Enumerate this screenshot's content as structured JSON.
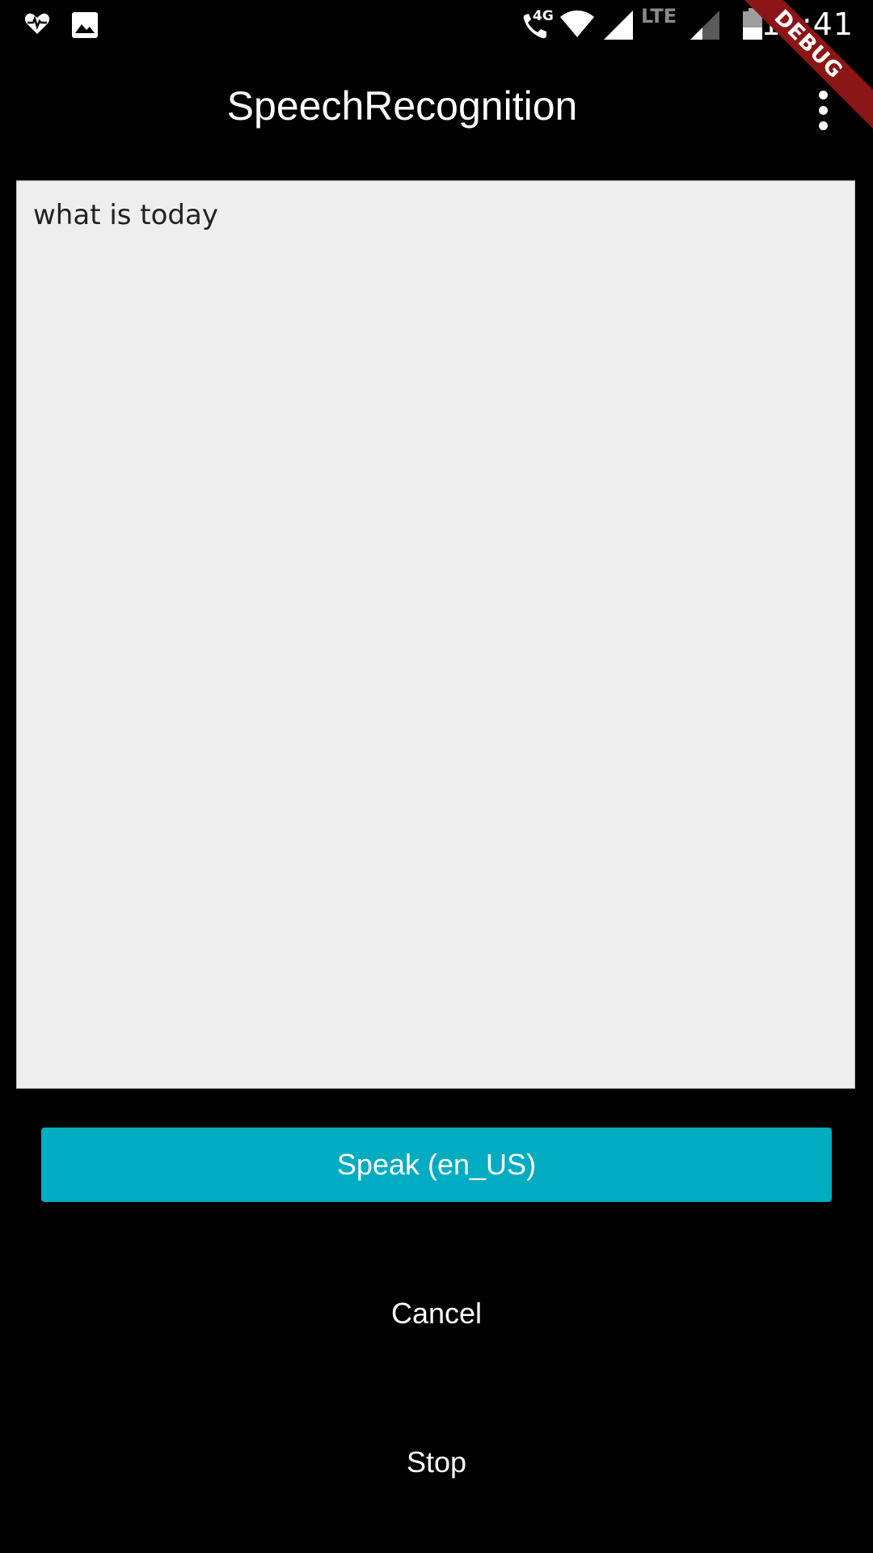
{
  "status_bar": {
    "time": "12:41",
    "network_4g": "4G",
    "network_lte": "LTE",
    "icons": [
      "health-icon",
      "image-icon",
      "wifi-call-icon",
      "wifi-icon",
      "signal-icon",
      "signal-weak-icon",
      "battery-icon"
    ]
  },
  "debug_banner": "DEBUG",
  "app_bar": {
    "title": "SpeechRecognition",
    "menu_icon": "more-vert-icon"
  },
  "transcript": {
    "text": "what is today"
  },
  "buttons": {
    "speak_label": "Speak (en_US)",
    "cancel_label": "Cancel",
    "stop_label": "Stop"
  },
  "colors": {
    "background": "#000000",
    "accent": "#00acc1",
    "panel": "#eeeeee",
    "debug": "#8b1515"
  }
}
